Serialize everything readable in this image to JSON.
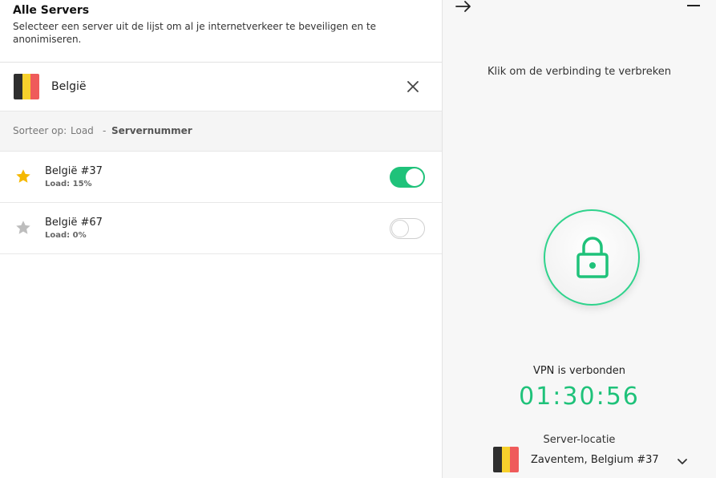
{
  "header": {
    "title": "Alle Servers",
    "subtitle": "Selecteer een server uit de lijst om al je internetverkeer te beveiligen en te anonimiseren."
  },
  "country": {
    "name": "België",
    "flag_colors": [
      "#2f2f2f",
      "#f7d02c",
      "#ef5b5b"
    ]
  },
  "sort": {
    "label": "Sorteer op:",
    "option_load": "Load",
    "separator": "-",
    "option_number": "Servernummer"
  },
  "servers": [
    {
      "name": "België #37",
      "load": "Load: 15%",
      "favorite": true,
      "connected": true
    },
    {
      "name": "België #67",
      "load": "Load: 0%",
      "favorite": false,
      "connected": false
    }
  ],
  "vpn": {
    "hint": "Klik om de verbinding te verbreken",
    "status": "VPN is verbonden",
    "timer": "01:30:56",
    "location_label": "Server-locatie",
    "location_name": "Zaventem, Belgium #37"
  },
  "colors": {
    "accent": "#1fc27a",
    "star_active": "#f5b800",
    "star_inactive": "#bdbdbd"
  },
  "icons": [
    "close-icon",
    "star-icon",
    "arrow-right-icon",
    "minimize-icon",
    "lock-icon",
    "chevron-down-icon"
  ]
}
